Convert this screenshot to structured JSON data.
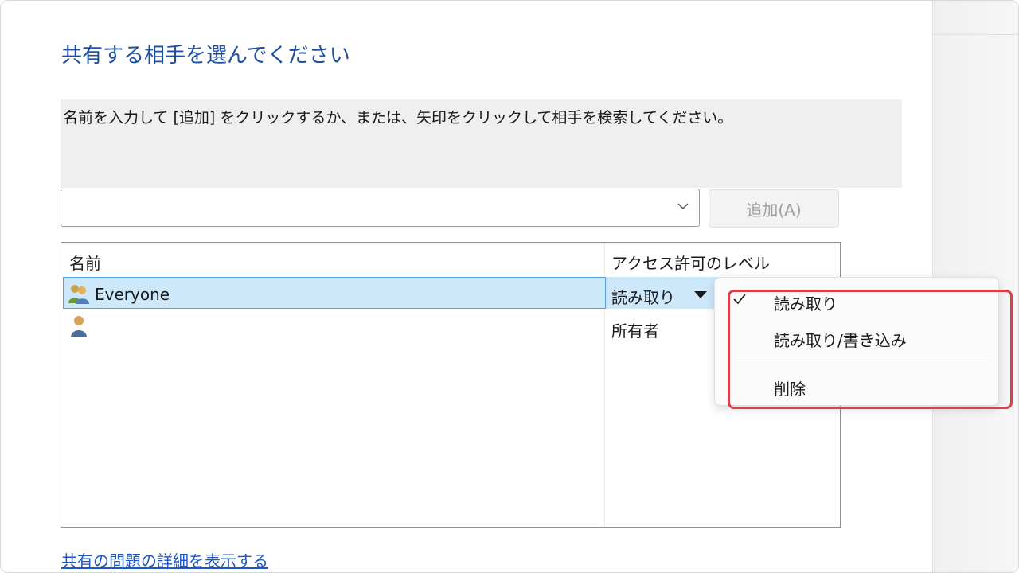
{
  "dialog": {
    "title": "共有する相手を選んでください",
    "instruction": "名前を入力して [追加] をクリックするか、または、矢印をクリックして相手を検索してください。"
  },
  "name_input": {
    "value": "",
    "placeholder": ""
  },
  "add_button_label": "追加(A)",
  "table": {
    "columns": [
      "名前",
      "アクセス許可のレベル"
    ],
    "rows": [
      {
        "name": "Everyone",
        "icon": "users-group-icon",
        "permission": "読み取り"
      },
      {
        "name": "",
        "icon": "user-icon",
        "permission": "所有者"
      }
    ]
  },
  "permission_menu": {
    "items": [
      {
        "label": "読み取り",
        "checked": true
      },
      {
        "label": "読み取り/書き込み",
        "checked": false
      },
      {
        "label": "削除",
        "checked": false
      }
    ]
  },
  "footer_link": "共有の問題の詳細を表示する",
  "colors": {
    "title": "#1f4e9e",
    "link": "#1f56c3",
    "selection": "#cde8fb",
    "highlight": "#d9404a"
  }
}
